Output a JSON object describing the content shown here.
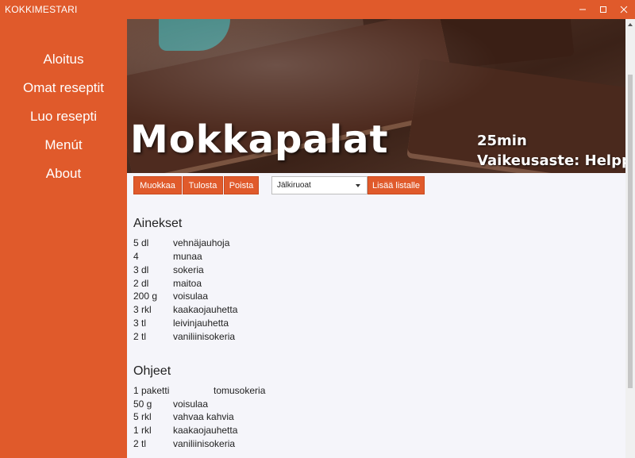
{
  "window": {
    "title": "KOKKIMESTARI"
  },
  "sidebar": {
    "items": [
      {
        "label": "Aloitus"
      },
      {
        "label": "Omat reseptit"
      },
      {
        "label": "Luo resepti"
      },
      {
        "label": "Menút"
      },
      {
        "label": "About"
      }
    ]
  },
  "recipe": {
    "title": "Mokkapalat",
    "time": "25min",
    "difficulty": "Vaikeusaste: Helppo"
  },
  "toolbar": {
    "edit_label": "Muokkaa",
    "print_label": "Tulosta",
    "delete_label": "Poista",
    "category_selected": "Jälkiruoat",
    "add_to_list_label": "Lisää listalle"
  },
  "ingredients": {
    "heading": "Ainekset",
    "rows": [
      {
        "amount": "5 dl",
        "name": "vehnäjauhoja"
      },
      {
        "amount": "4",
        "name": "munaa"
      },
      {
        "amount": "3 dl",
        "name": "sokeria"
      },
      {
        "amount": "2 dl",
        "name": "maitoa"
      },
      {
        "amount": "200 g",
        "name": "voisulaa"
      },
      {
        "amount": "3 rkl",
        "name": "kaakaojauhetta"
      },
      {
        "amount": "3 tl",
        "name": "leivinjauhetta"
      },
      {
        "amount": "2 tl",
        "name": "vaniliinisokeria"
      }
    ]
  },
  "instructions": {
    "heading": "Ohjeet",
    "rows": [
      {
        "amount": "1 paketti",
        "name": "tomusokeria"
      },
      {
        "amount": "50 g",
        "name": "voisulaa"
      },
      {
        "amount": "5 rkl",
        "name": "vahvaa kahvia"
      },
      {
        "amount": "1 rkl",
        "name": "kaakaojauhetta"
      },
      {
        "amount": "2 tl",
        "name": "vaniliinisokeria"
      }
    ]
  },
  "colors": {
    "accent": "#e05a2b",
    "content_bg": "#f5f5fa"
  }
}
